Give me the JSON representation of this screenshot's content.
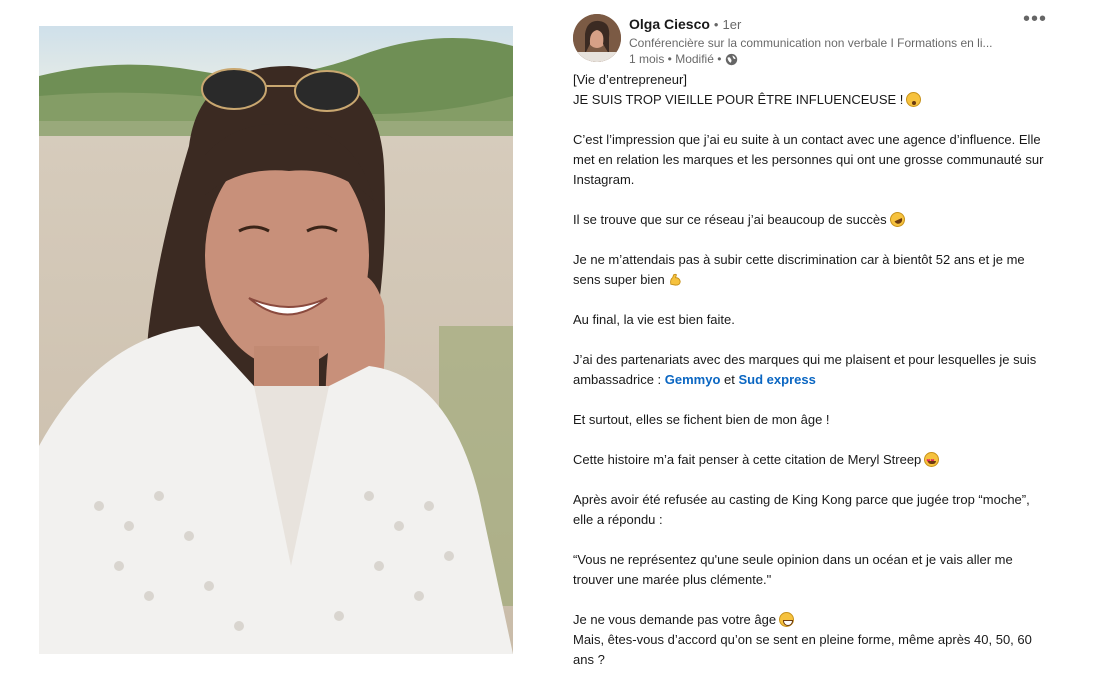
{
  "post": {
    "author": {
      "name": "Olga Ciesco",
      "separator": "•",
      "degree": "1er",
      "headline": "Conférencière sur la communication non verbale I Formations en li...",
      "time": "1 mois • Modifié •",
      "visibility_icon": "globe-icon"
    },
    "more_icon": "more-options-icon",
    "more_label": "•••",
    "paragraphs": {
      "p1": "[Vie d’entrepreneur]",
      "p2": "JE SUIS TROP VIEILLE POUR ÊTRE INFLUENCEUSE !",
      "p3": "C’est l’impression que j’ai eu suite à un contact avec une agence d’influence. Elle met en relation les marques et les personnes qui ont une grosse communauté sur Instagram.",
      "p4": "Il se trouve que sur ce réseau j’ai beaucoup de succès",
      "p5": "Je ne m’attendais pas à subir cette discrimination car à bientôt 52 ans et je me sens super bien",
      "p6": "Au final, la vie est bien faite.",
      "p7_start": "J’ai des partenariats avec des marques qui me plaisent et pour lesquelles je suis ambassadrice :",
      "p7_link1": "Gemmyo",
      "p7_and": "et",
      "p7_link2": "Sud express",
      "p8": "Et surtout, elles se fichent bien de mon âge !",
      "p9": "Cette histoire m’a fait penser à cette citation de Meryl Streep",
      "p10": "Après avoir été refusée au casting de King Kong parce que jugée trop “moche”, elle a répondu :",
      "p11": "“Vous ne représentez qu'une seule opinion dans un océan et je vais aller me trouver une marée plus clémente.\"",
      "p12": "Je ne vous demande pas votre âge",
      "p13": "Mais, êtes-vous d’accord qu’on se sent en pleine forme, même après 40, 50, 60 ans ?"
    },
    "emojis": [
      "hushed-face-icon",
      "rolling-laughing-icon",
      "flexed-biceps-icon",
      "star-struck-icon",
      "grinning-sweat-icon"
    ],
    "colors": {
      "link": "#0a66c2",
      "text": "rgba(0,0,0,0.9)",
      "secondary": "rgba(0,0,0,0.6)"
    }
  }
}
